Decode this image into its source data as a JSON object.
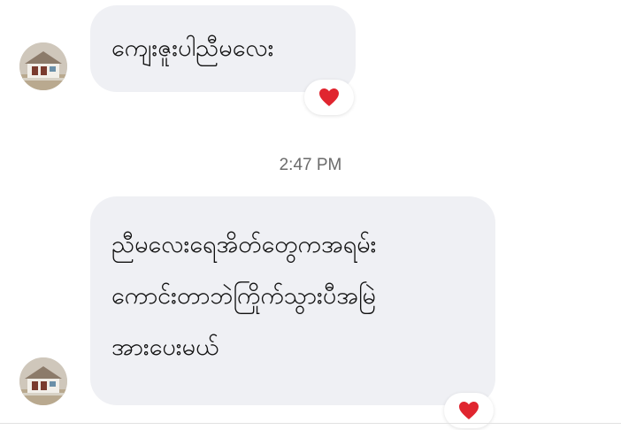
{
  "messages": [
    {
      "lines": [
        "ကျေးဇူးပါညီမလေး"
      ],
      "reaction": "heart-icon",
      "avatar": "contact-avatar-house"
    },
    {
      "lines": [
        "ညီမလေးရေအိတ်တွေကအရမ်း",
        "ကောင်းတာဘဲကြိုက်သွားပီအမြဲ",
        "အားပေးမယ်"
      ],
      "reaction": "heart-icon",
      "avatar": "contact-avatar-house"
    }
  ],
  "timestamp": "2:47 PM",
  "colors": {
    "bubble": "#eff0f4",
    "heart": "#e0252f",
    "timestamp": "#6b6b6b"
  }
}
